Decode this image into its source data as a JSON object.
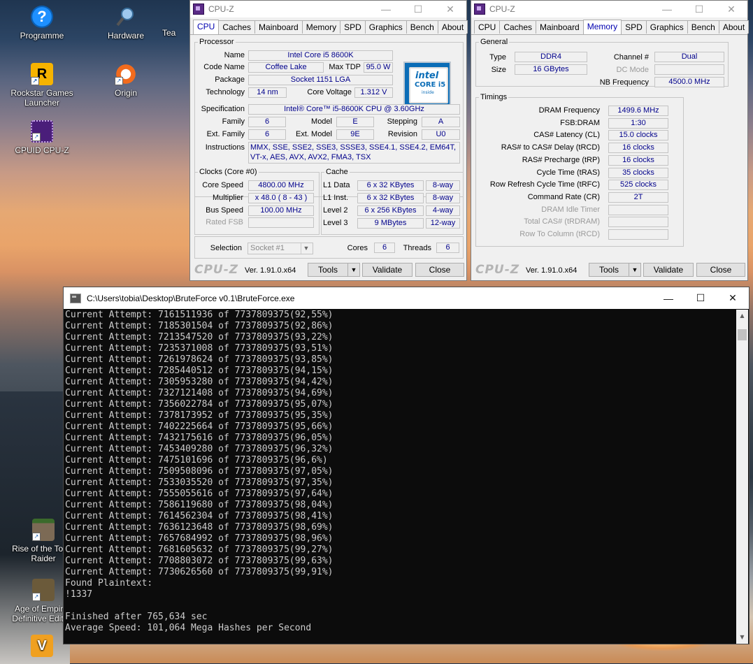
{
  "desktop": {
    "icons": [
      {
        "name": "desktop-icon-programme",
        "label": "Programme"
      },
      {
        "name": "desktop-icon-hardware",
        "label": "Hardware"
      },
      {
        "name": "desktop-icon-team",
        "label": "Tea"
      },
      {
        "name": "desktop-icon-rockstar",
        "label": "Rockstar Games Launcher"
      },
      {
        "name": "desktop-icon-origin",
        "label": "Origin"
      },
      {
        "name": "desktop-icon-cpuid",
        "label": "CPUID CPU-Z"
      },
      {
        "name": "desktop-icon-tomb-raider",
        "label": "Rise of the Tomb Raider"
      },
      {
        "name": "desktop-icon-age-of-empires",
        "label": "Age of Empires Definitive Edition"
      }
    ]
  },
  "cpuz_cpu": {
    "title": "CPU-Z",
    "tabs": [
      "CPU",
      "Caches",
      "Mainboard",
      "Memory",
      "SPD",
      "Graphics",
      "Bench",
      "About"
    ],
    "active_tab": "CPU",
    "processor": {
      "legend": "Processor",
      "name_label": "Name",
      "name": "Intel Core i5 8600K",
      "codename_label": "Code Name",
      "codename": "Coffee Lake",
      "maxtdp_label": "Max TDP",
      "maxtdp": "95.0 W",
      "package_label": "Package",
      "package": "Socket 1151 LGA",
      "technology_label": "Technology",
      "technology": "14 nm",
      "voltage_label": "Core Voltage",
      "voltage": "1.312 V",
      "spec_label": "Specification",
      "spec": "Intel® Core™ i5-8600K CPU @ 3.60GHz",
      "family_label": "Family",
      "family": "6",
      "model_label": "Model",
      "model": "E",
      "stepping_label": "Stepping",
      "stepping": "A",
      "extfamily_label": "Ext. Family",
      "extfamily": "6",
      "extmodel_label": "Ext. Model",
      "extmodel": "9E",
      "revision_label": "Revision",
      "revision": "U0",
      "instr_label": "Instructions",
      "instructions": "MMX, SSE, SSE2, SSE3, SSSE3, SSE4.1, SSE4.2, EM64T, VT-x, AES, AVX, AVX2, FMA3, TSX",
      "logo_brand": "intel",
      "logo_model": "CORE i5",
      "logo_sub": "inside"
    },
    "clocks": {
      "legend": "Clocks (Core #0)",
      "corespeed_label": "Core Speed",
      "corespeed": "4800.00 MHz",
      "multiplier_label": "Multiplier",
      "multiplier": "x 48.0 ( 8 - 43 )",
      "busspeed_label": "Bus Speed",
      "busspeed": "100.00 MHz",
      "ratedfsb_label": "Rated FSB",
      "ratedfsb": ""
    },
    "cache": {
      "legend": "Cache",
      "rows": [
        {
          "label": "L1 Data",
          "size": "6 x 32 KBytes",
          "way": "8-way"
        },
        {
          "label": "L1 Inst.",
          "size": "6 x 32 KBytes",
          "way": "8-way"
        },
        {
          "label": "Level 2",
          "size": "6 x 256 KBytes",
          "way": "4-way"
        },
        {
          "label": "Level 3",
          "size": "9 MBytes",
          "way": "12-way"
        }
      ]
    },
    "selection_label": "Selection",
    "selection": "Socket #1",
    "cores_label": "Cores",
    "cores": "6",
    "threads_label": "Threads",
    "threads": "6",
    "footer": {
      "brand": "CPU-Z",
      "version": "Ver. 1.91.0.x64",
      "tools": "Tools",
      "validate": "Validate",
      "close": "Close"
    }
  },
  "cpuz_mem": {
    "title": "CPU-Z",
    "tabs": [
      "CPU",
      "Caches",
      "Mainboard",
      "Memory",
      "SPD",
      "Graphics",
      "Bench",
      "About"
    ],
    "active_tab": "Memory",
    "general": {
      "legend": "General",
      "type_label": "Type",
      "type": "DDR4",
      "size_label": "Size",
      "size": "16 GBytes",
      "channel_label": "Channel #",
      "channel": "Dual",
      "dcmode_label": "DC Mode",
      "dcmode": "",
      "nbfreq_label": "NB Frequency",
      "nbfreq": "4500.0 MHz"
    },
    "timings": {
      "legend": "Timings",
      "rows": [
        {
          "label": "DRAM Frequency",
          "value": "1499.6 MHz",
          "dim": false
        },
        {
          "label": "FSB:DRAM",
          "value": "1:30",
          "dim": false
        },
        {
          "label": "CAS# Latency (CL)",
          "value": "15.0 clocks",
          "dim": false
        },
        {
          "label": "RAS# to CAS# Delay (tRCD)",
          "value": "16 clocks",
          "dim": false
        },
        {
          "label": "RAS# Precharge (tRP)",
          "value": "16 clocks",
          "dim": false
        },
        {
          "label": "Cycle Time (tRAS)",
          "value": "35 clocks",
          "dim": false
        },
        {
          "label": "Row Refresh Cycle Time (tRFC)",
          "value": "525 clocks",
          "dim": false
        },
        {
          "label": "Command Rate (CR)",
          "value": "2T",
          "dim": false
        },
        {
          "label": "DRAM Idle Timer",
          "value": "",
          "dim": true
        },
        {
          "label": "Total CAS# (tRDRAM)",
          "value": "",
          "dim": true
        },
        {
          "label": "Row To Column (tRCD)",
          "value": "",
          "dim": true
        }
      ]
    },
    "footer": {
      "brand": "CPU-Z",
      "version": "Ver. 1.91.0.x64",
      "tools": "Tools",
      "validate": "Validate",
      "close": "Close"
    }
  },
  "console": {
    "title": "C:\\Users\\tobia\\Desktop\\BruteForce v0.1\\BruteForce.exe",
    "lines": [
      "Current Attempt: 7161511936 of 7737809375(92,55%)",
      "Current Attempt: 7185301504 of 7737809375(92,86%)",
      "Current Attempt: 7213547520 of 7737809375(93,22%)",
      "Current Attempt: 7235371008 of 7737809375(93,51%)",
      "Current Attempt: 7261978624 of 7737809375(93,85%)",
      "Current Attempt: 7285440512 of 7737809375(94,15%)",
      "Current Attempt: 7305953280 of 7737809375(94,42%)",
      "Current Attempt: 7327121408 of 7737809375(94,69%)",
      "Current Attempt: 7356022784 of 7737809375(95,07%)",
      "Current Attempt: 7378173952 of 7737809375(95,35%)",
      "Current Attempt: 7402225664 of 7737809375(95,66%)",
      "Current Attempt: 7432175616 of 7737809375(96,05%)",
      "Current Attempt: 7453409280 of 7737809375(96,32%)",
      "Current Attempt: 7475101696 of 7737809375(96,6%)",
      "Current Attempt: 7509508096 of 7737809375(97,05%)",
      "Current Attempt: 7533035520 of 7737809375(97,35%)",
      "Current Attempt: 7555055616 of 7737809375(97,64%)",
      "Current Attempt: 7586119680 of 7737809375(98,04%)",
      "Current Attempt: 7614562304 of 7737809375(98,41%)",
      "Current Attempt: 7636123648 of 7737809375(98,69%)",
      "Current Attempt: 7657684992 of 7737809375(98,96%)",
      "Current Attempt: 7681605632 of 7737809375(99,27%)",
      "Current Attempt: 7708803072 of 7737809375(99,63%)",
      "Current Attempt: 7730626560 of 7737809375(99,91%)",
      "Found Plaintext:",
      "!1337",
      "",
      "Finished after 765,634 sec",
      "Average Speed: 101,064 Mega Hashes per Second"
    ]
  }
}
